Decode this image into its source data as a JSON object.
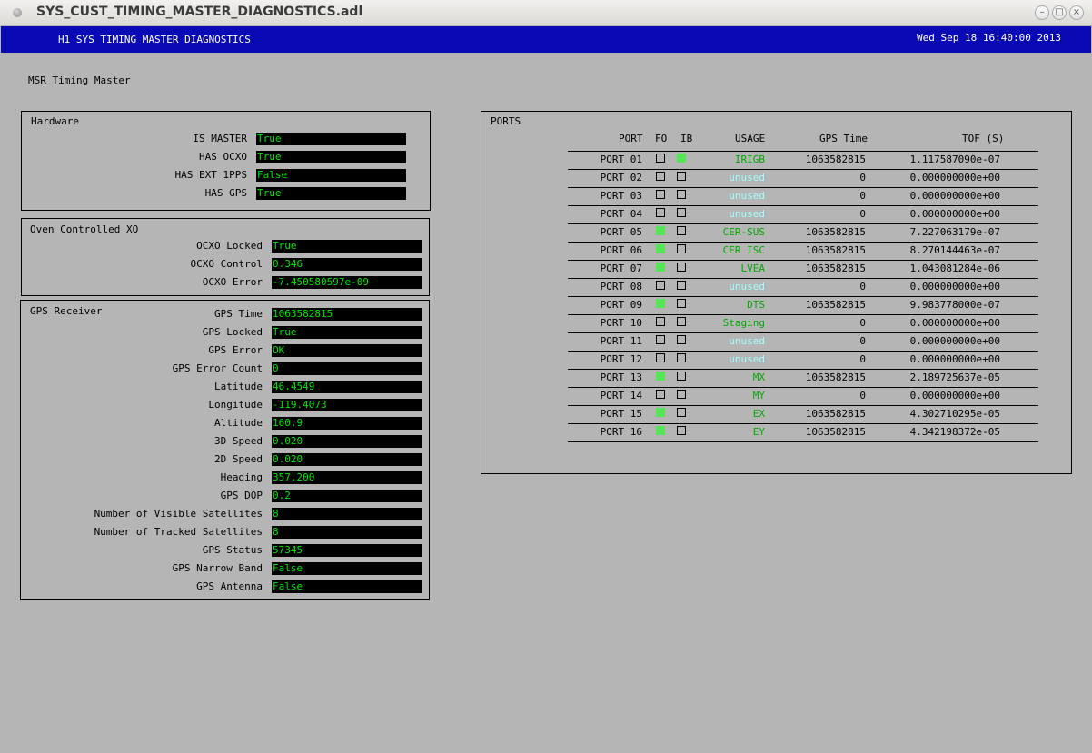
{
  "window": {
    "title": "SYS_CUST_TIMING_MASTER_DIAGNOSTICS.adl"
  },
  "banner": {
    "title": "H1 SYS TIMING MASTER DIAGNOSTICS",
    "datetime": "Wed Sep 18 16:40:00 2013"
  },
  "subtitle": "MSR Timing Master",
  "hardware": {
    "title": "Hardware",
    "rows": [
      {
        "label": "IS MASTER",
        "value": "True"
      },
      {
        "label": "HAS OCXO",
        "value": "True"
      },
      {
        "label": "HAS EXT 1PPS",
        "value": "False"
      },
      {
        "label": "HAS GPS",
        "value": "True"
      }
    ]
  },
  "ocxo": {
    "title": "Oven Controlled XO",
    "rows": [
      {
        "label": "OCXO Locked",
        "value": "True"
      },
      {
        "label": "OCXO Control",
        "value": "0.346"
      },
      {
        "label": "OCXO Error",
        "value": "-7.450580597e-09"
      }
    ]
  },
  "gps": {
    "title": "GPS Receiver",
    "rows": [
      {
        "label": "GPS Time",
        "value": "1063582815"
      },
      {
        "label": "GPS Locked",
        "value": "True"
      },
      {
        "label": "GPS Error",
        "value": "OK"
      },
      {
        "label": "GPS Error Count",
        "value": "0"
      },
      {
        "label": "Latitude",
        "value": "46.4549"
      },
      {
        "label": "Longitude",
        "value": "-119.4073"
      },
      {
        "label": "Altitude",
        "value": "160.9"
      },
      {
        "label": "3D Speed",
        "value": "0.020"
      },
      {
        "label": "2D Speed",
        "value": "0.020"
      },
      {
        "label": "Heading",
        "value": "357.200"
      },
      {
        "label": "GPS DOP",
        "value": "0.2"
      },
      {
        "label": "Number of Visible Satellites",
        "value": "8"
      },
      {
        "label": "Number of Tracked Satellites",
        "value": "8"
      },
      {
        "label": "GPS Status",
        "value": "57345"
      },
      {
        "label": "GPS Narrow Band",
        "value": "False"
      },
      {
        "label": "GPS Antenna",
        "value": "False"
      }
    ]
  },
  "ports": {
    "title": "PORTS",
    "headers": {
      "port": "PORT",
      "fo": "FO",
      "ib": "IB",
      "usage": "USAGE",
      "gps_time": "GPS Time",
      "tof": "TOF (S)"
    },
    "colors": {
      "active": "#00aa00",
      "unused": "#a0ffff",
      "indicator_on": "#55e655"
    },
    "rows": [
      {
        "port": "PORT 01",
        "fo": false,
        "ib": true,
        "usage": "IRIGB",
        "unused": false,
        "gps_time": "1063582815",
        "tof": "1.117587090e-07"
      },
      {
        "port": "PORT 02",
        "fo": false,
        "ib": false,
        "usage": "unused",
        "unused": true,
        "gps_time": "0",
        "tof": "0.000000000e+00"
      },
      {
        "port": "PORT 03",
        "fo": false,
        "ib": false,
        "usage": "unused",
        "unused": true,
        "gps_time": "0",
        "tof": "0.000000000e+00"
      },
      {
        "port": "PORT 04",
        "fo": false,
        "ib": false,
        "usage": "unused",
        "unused": true,
        "gps_time": "0",
        "tof": "0.000000000e+00"
      },
      {
        "port": "PORT 05",
        "fo": true,
        "ib": false,
        "usage": "CER-SUS",
        "unused": false,
        "gps_time": "1063582815",
        "tof": "7.227063179e-07"
      },
      {
        "port": "PORT 06",
        "fo": true,
        "ib": false,
        "usage": "CER ISC",
        "unused": false,
        "gps_time": "1063582815",
        "tof": "8.270144463e-07"
      },
      {
        "port": "PORT 07",
        "fo": true,
        "ib": false,
        "usage": "LVEA",
        "unused": false,
        "gps_time": "1063582815",
        "tof": "1.043081284e-06"
      },
      {
        "port": "PORT 08",
        "fo": false,
        "ib": false,
        "usage": "unused",
        "unused": true,
        "gps_time": "0",
        "tof": "0.000000000e+00"
      },
      {
        "port": "PORT 09",
        "fo": true,
        "ib": false,
        "usage": "DTS",
        "unused": false,
        "gps_time": "1063582815",
        "tof": "9.983778000e-07"
      },
      {
        "port": "PORT 10",
        "fo": false,
        "ib": false,
        "usage": "Staging",
        "unused": false,
        "gps_time": "0",
        "tof": "0.000000000e+00"
      },
      {
        "port": "PORT 11",
        "fo": false,
        "ib": false,
        "usage": "unused",
        "unused": true,
        "gps_time": "0",
        "tof": "0.000000000e+00"
      },
      {
        "port": "PORT 12",
        "fo": false,
        "ib": false,
        "usage": "unused",
        "unused": true,
        "gps_time": "0",
        "tof": "0.000000000e+00"
      },
      {
        "port": "PORT 13",
        "fo": true,
        "ib": false,
        "usage": "MX",
        "unused": false,
        "gps_time": "1063582815",
        "tof": "2.189725637e-05"
      },
      {
        "port": "PORT 14",
        "fo": false,
        "ib": false,
        "usage": "MY",
        "unused": false,
        "gps_time": "0",
        "tof": "0.000000000e+00"
      },
      {
        "port": "PORT 15",
        "fo": true,
        "ib": false,
        "usage": "EX",
        "unused": false,
        "gps_time": "1063582815",
        "tof": "4.302710295e-05"
      },
      {
        "port": "PORT 16",
        "fo": true,
        "ib": false,
        "usage": "EY",
        "unused": false,
        "gps_time": "1063582815",
        "tof": "4.342198372e-05"
      }
    ]
  }
}
